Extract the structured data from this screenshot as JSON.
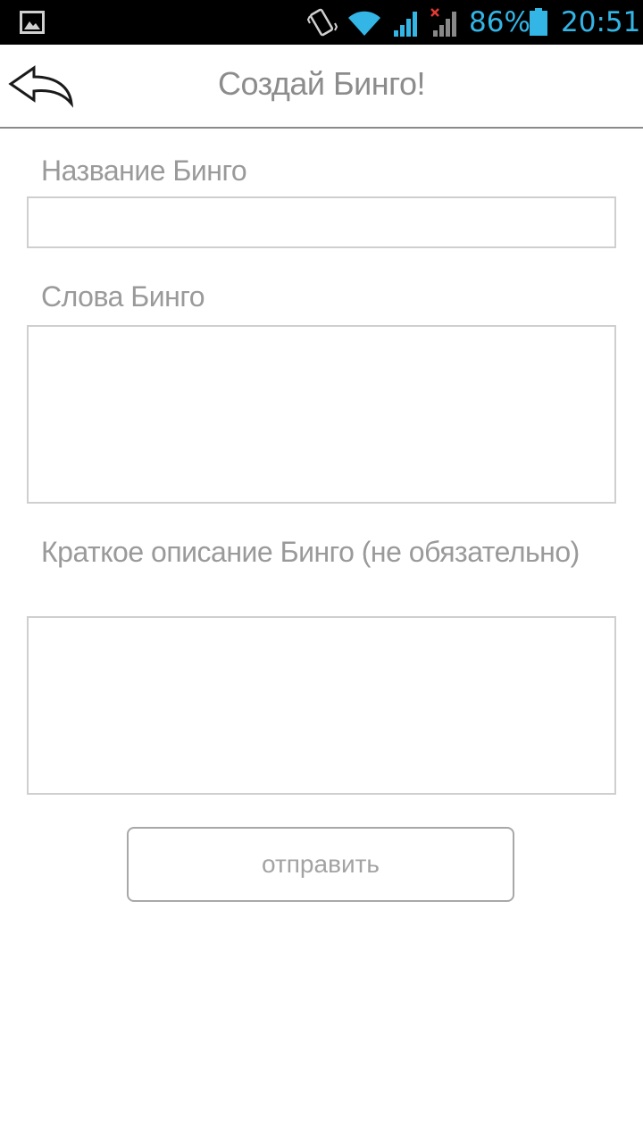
{
  "status_bar": {
    "battery_percent": "86%",
    "time": "20:51",
    "accent_color": "#33b5e5",
    "icons": [
      "gallery-icon",
      "vibrate-icon",
      "wifi-icon",
      "signal-icon",
      "signal-no-sim-icon",
      "battery-icon"
    ]
  },
  "header": {
    "title": "Создай Бинго!",
    "back_icon": "back-arrow-icon"
  },
  "form": {
    "name_label": "Название Бинго",
    "name_value": "",
    "words_label": "Слова Бинго",
    "words_value": "",
    "description_label": "Краткое описание Бинго (не обязательно)",
    "description_value": "",
    "submit_label": "отправить"
  }
}
